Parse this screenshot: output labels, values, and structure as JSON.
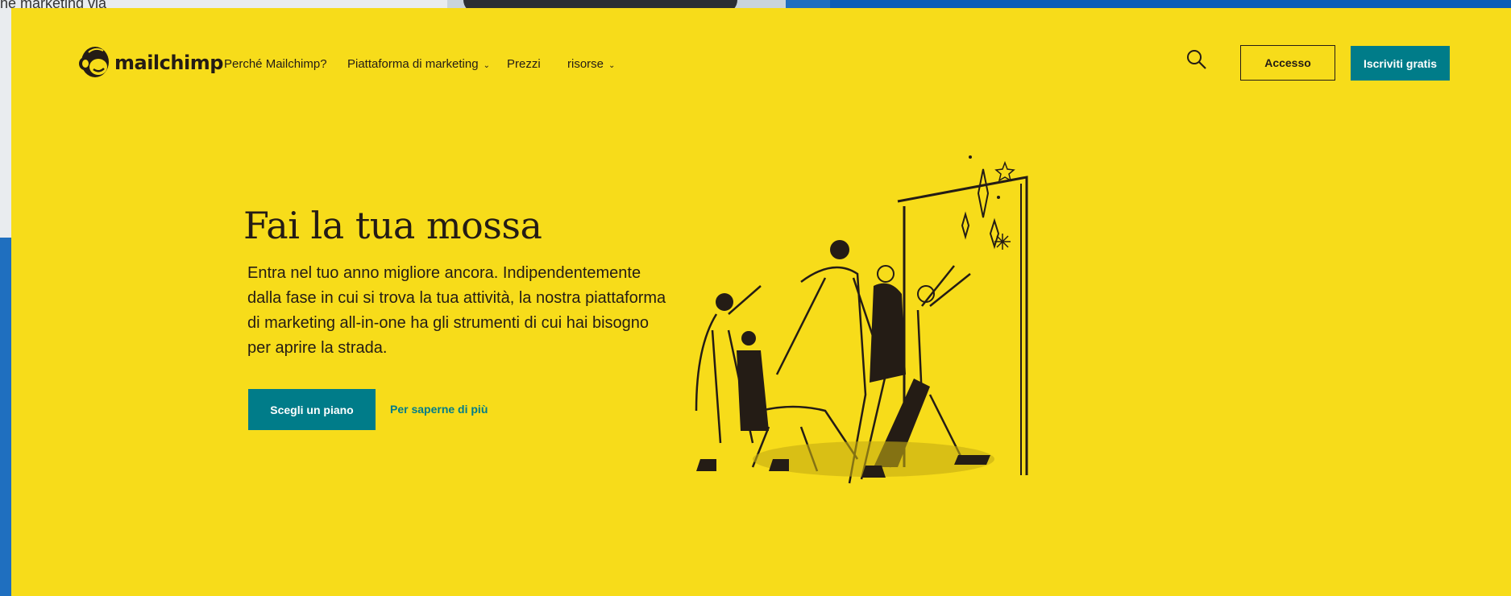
{
  "background": {
    "left_text": "he marketing via"
  },
  "brand": {
    "name": "mailchimp",
    "logo_icon": "freddie-monkey-icon",
    "accent": "#007c89",
    "page_bg": "#f7dc1a",
    "text": "#241c15"
  },
  "nav": {
    "items": [
      {
        "label": "Perché Mailchimp?",
        "has_dropdown": false
      },
      {
        "label": "Piattaforma di marketing",
        "has_dropdown": true
      },
      {
        "label": "Prezzi",
        "has_dropdown": false
      },
      {
        "label": "risorse",
        "has_dropdown": true
      }
    ],
    "search_icon": "search-icon",
    "login_label": "Accesso",
    "signup_label": "Iscriviti gratis"
  },
  "hero": {
    "title": "Fai la tua mossa",
    "body": "Entra nel tuo anno migliore ancora. Indipendentemente dalla fase in cui si trova la tua attività, la nostra piattaforma di marketing all-in-one ha gli strumenti di cui hai bisogno per aprire la strada.",
    "primary_cta": "Scegli un piano",
    "secondary_cta": "Per saperne di più",
    "illustration_icon": "people-through-doorway-illustration"
  }
}
